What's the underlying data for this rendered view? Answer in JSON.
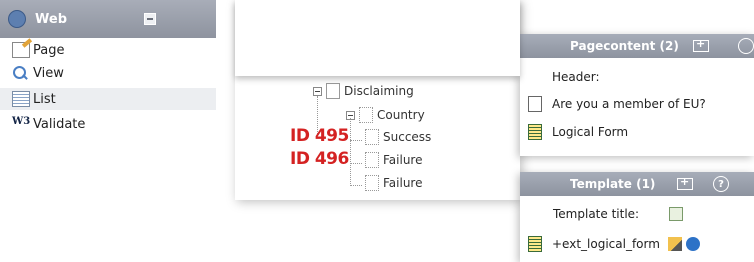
{
  "module_menu": {
    "title": "Web",
    "items": [
      {
        "label": "Page",
        "icon": "page-edit-icon"
      },
      {
        "label": "View",
        "icon": "magnifier-icon"
      },
      {
        "label": "List",
        "icon": "list-icon",
        "active": true
      },
      {
        "label": "Validate",
        "icon": "w3c-icon",
        "icon_text": "W3"
      }
    ]
  },
  "page_tree": {
    "nodes": [
      {
        "label": "Disclaiming"
      },
      {
        "label": "Country"
      },
      {
        "label": "Success"
      },
      {
        "label": "Failure"
      },
      {
        "label": "Failure"
      }
    ],
    "annotations": [
      {
        "label": "ID 495"
      },
      {
        "label": "ID 496"
      }
    ],
    "annotation_color": "#d42222"
  },
  "pagecontent_panel": {
    "title": "Pagecontent (2)",
    "header_label": "Header:",
    "rows": [
      {
        "label": "Are you a member of EU?",
        "icon": "document-icon"
      },
      {
        "label": "Logical Form",
        "icon": "form-icon"
      }
    ]
  },
  "template_panel": {
    "title": "Template (1)",
    "help_label": "?",
    "title_label": "Template title:",
    "record_label": "+ext_logical_form"
  }
}
